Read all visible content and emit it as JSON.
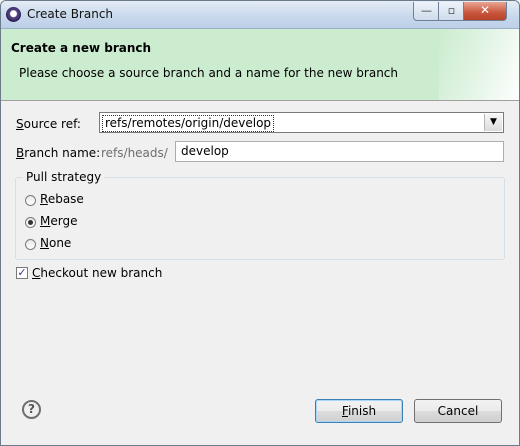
{
  "window": {
    "title": "Create Branch",
    "minimize_glyph": "—",
    "maximize_glyph": "▫",
    "close_glyph": "✕"
  },
  "banner": {
    "title": "Create a new branch",
    "message": "Please choose a source branch and a name for the new branch"
  },
  "form": {
    "source_ref_label_hotkey": "S",
    "source_ref_label_rest": "ource ref:",
    "source_ref_value": "refs/remotes/origin/develop",
    "branch_name_label_hotkey": "B",
    "branch_name_label_rest": "ranch name:",
    "branch_prefix": "refs/heads/",
    "branch_name_value": "develop"
  },
  "pull_strategy": {
    "label": "Pull strategy",
    "options": [
      {
        "hotkey": "R",
        "rest": "ebase",
        "selected": false
      },
      {
        "hotkey": "M",
        "rest": "erge",
        "selected": true
      },
      {
        "hotkey": "N",
        "rest": "one",
        "selected": false
      }
    ]
  },
  "checkout": {
    "hotkey": "C",
    "rest": "heckout new branch",
    "checked": true,
    "check_glyph": "✓"
  },
  "footer": {
    "help_glyph": "?",
    "finish_hotkey": "F",
    "finish_rest": "inish",
    "cancel_label": "Cancel"
  },
  "colors": {
    "banner_bg": "#cbeccf",
    "default_button_border": "#3c7fb1"
  }
}
